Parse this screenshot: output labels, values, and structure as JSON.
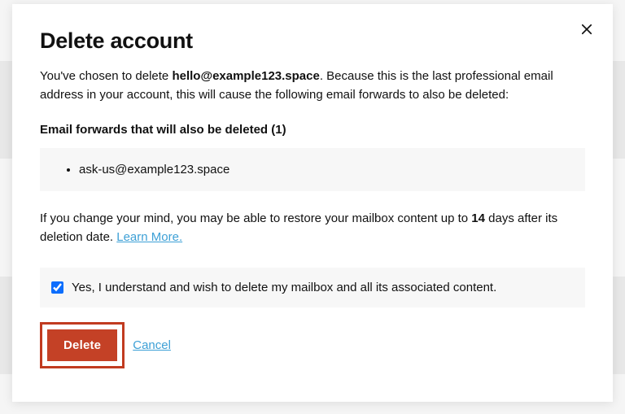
{
  "modal": {
    "title": "Delete account",
    "intro_prefix": "You've chosen to delete ",
    "intro_email": "hello@example123.space",
    "intro_suffix": ". Because this is the last professional email address in your account, this will cause the following email forwards to also be deleted:",
    "forwards_heading": "Email forwards that will also be deleted (1)",
    "forwards": [
      "ask-us@example123.space"
    ],
    "restore_prefix": "If you change your mind, you may be able to restore your mailbox content up to ",
    "restore_days": "14",
    "restore_suffix": " days after its deletion date. ",
    "learn_more_label": "Learn More.",
    "confirm_label": "Yes, I understand and wish to delete my mailbox and all its associated content.",
    "confirm_checked": true,
    "delete_label": "Delete",
    "cancel_label": "Cancel"
  }
}
